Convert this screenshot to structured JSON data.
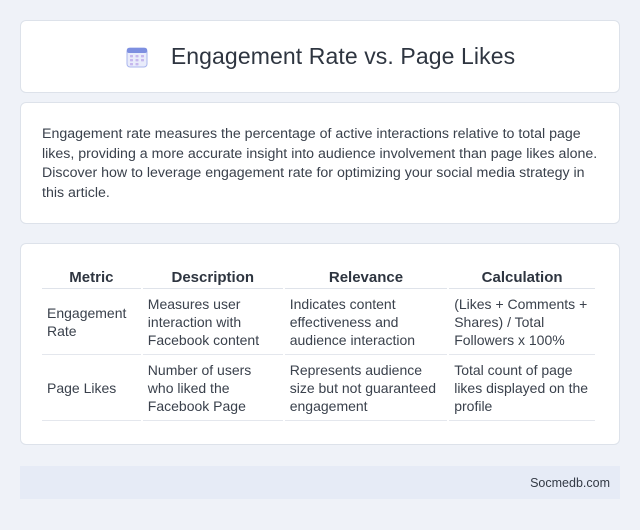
{
  "header": {
    "title": "Engagement Rate vs. Page Likes",
    "icon": "calendar-icon",
    "icon_color": "#6b7fd6"
  },
  "intro": {
    "text": "Engagement rate measures the percentage of active interactions relative to total page likes, providing a more accurate insight into audience involvement than page likes alone. Discover how to leverage engagement rate for optimizing your social media strategy in this article."
  },
  "table": {
    "columns": [
      "Metric",
      "Description",
      "Relevance",
      "Calculation"
    ],
    "rows": [
      [
        "Engagement Rate",
        "Measures user interaction with Facebook content",
        "Indicates content effectiveness and audience interaction",
        "(Likes + Comments + Shares) / Total Followers x 100%"
      ],
      [
        "Page Likes",
        "Number of users who liked the Facebook Page",
        "Represents audience size but not guaranteed engagement",
        "Total count of page likes displayed on the profile"
      ]
    ]
  },
  "footer": {
    "text": "Socmedb.com"
  }
}
